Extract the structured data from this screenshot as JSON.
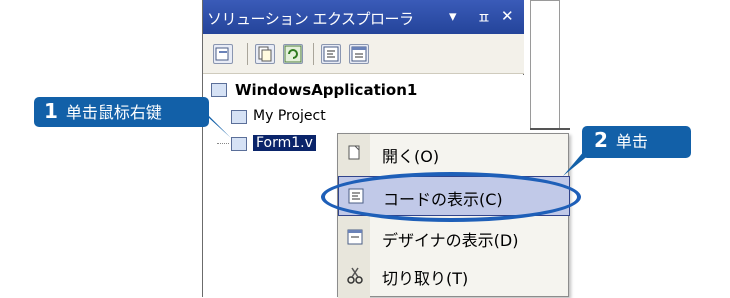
{
  "window": {
    "title": "ソリューション エクスプローラ",
    "pin_glyph": "▾",
    "pin2_glyph": "ꟻ",
    "close_glyph": "✕"
  },
  "toolbar": {
    "buttons": [
      "properties-icon",
      "show-all-files-icon",
      "refresh-icon",
      "view-code-icon",
      "view-designer-icon"
    ]
  },
  "tree": {
    "solution": "WindowsApplication1",
    "my_project": "My Project",
    "form1": "Form1.v"
  },
  "context_menu": {
    "items": [
      {
        "label": "開く(O)",
        "icon": "open-icon"
      },
      {
        "label": "コードの表示(C)",
        "icon": "view-code-icon",
        "highlighted": true
      },
      {
        "label": "デザイナの表示(D)",
        "icon": "view-designer-icon"
      },
      {
        "label": "切り取り(T)",
        "icon": "scissors-icon"
      }
    ]
  },
  "callouts": {
    "step1_num": "1",
    "step1_text": "单击鼠标右键",
    "step2_num": "2",
    "step2_text": "单击"
  },
  "colors": {
    "callout_bg": "#1260a8",
    "titlebar": "#2f4fa8",
    "highlight_ellipse": "#1e5fb8",
    "menu_highlight": "#c1c9e8"
  }
}
